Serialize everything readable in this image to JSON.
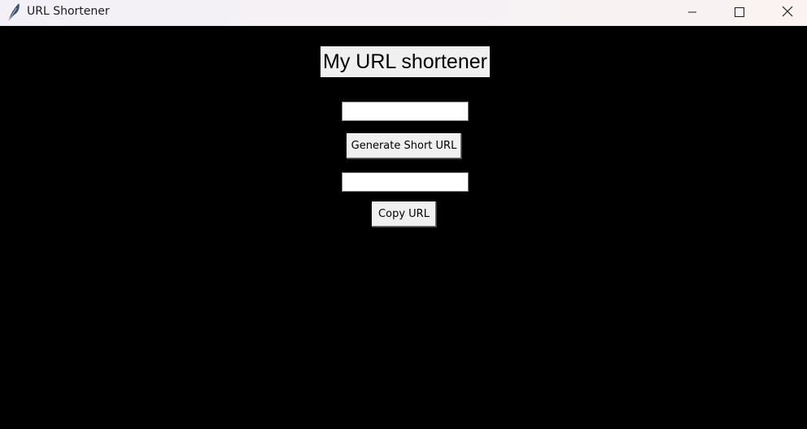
{
  "window": {
    "title": "URL Shortener",
    "app_icon": "feather-icon",
    "controls": {
      "minimize_icon": "minimize-icon",
      "maximize_icon": "maximize-icon",
      "close_icon": "close-icon"
    }
  },
  "main": {
    "heading": "My URL shortener",
    "url_input": {
      "value": "",
      "placeholder": ""
    },
    "generate_button_label": "Generate Short URL",
    "short_url_output": {
      "value": "",
      "placeholder": ""
    },
    "copy_button_label": "Copy URL"
  },
  "colors": {
    "background": "#000000",
    "widget_background": "#f0f0f0",
    "entry_background": "#ffffff"
  }
}
